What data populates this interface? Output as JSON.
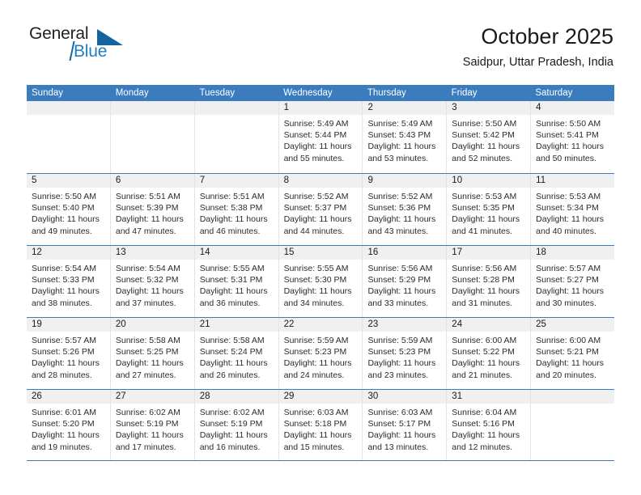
{
  "brand": {
    "name_part1": "General",
    "name_part2": "Blue",
    "accent_color": "#1f7ec4",
    "logo_icon": "triangle-flag-icon"
  },
  "header": {
    "month_title": "October 2025",
    "location": "Saidpur, Uttar Pradesh, India"
  },
  "calendar": {
    "header_color": "#3a7cbe",
    "day_band_color": "#f0f0f0",
    "weekdays": [
      "Sunday",
      "Monday",
      "Tuesday",
      "Wednesday",
      "Thursday",
      "Friday",
      "Saturday"
    ],
    "weeks": [
      [
        {
          "empty": true
        },
        {
          "empty": true
        },
        {
          "empty": true
        },
        {
          "day": "1",
          "sunrise": "Sunrise: 5:49 AM",
          "sunset": "Sunset: 5:44 PM",
          "daylight1": "Daylight: 11 hours",
          "daylight2": "and 55 minutes."
        },
        {
          "day": "2",
          "sunrise": "Sunrise: 5:49 AM",
          "sunset": "Sunset: 5:43 PM",
          "daylight1": "Daylight: 11 hours",
          "daylight2": "and 53 minutes."
        },
        {
          "day": "3",
          "sunrise": "Sunrise: 5:50 AM",
          "sunset": "Sunset: 5:42 PM",
          "daylight1": "Daylight: 11 hours",
          "daylight2": "and 52 minutes."
        },
        {
          "day": "4",
          "sunrise": "Sunrise: 5:50 AM",
          "sunset": "Sunset: 5:41 PM",
          "daylight1": "Daylight: 11 hours",
          "daylight2": "and 50 minutes."
        }
      ],
      [
        {
          "day": "5",
          "sunrise": "Sunrise: 5:50 AM",
          "sunset": "Sunset: 5:40 PM",
          "daylight1": "Daylight: 11 hours",
          "daylight2": "and 49 minutes."
        },
        {
          "day": "6",
          "sunrise": "Sunrise: 5:51 AM",
          "sunset": "Sunset: 5:39 PM",
          "daylight1": "Daylight: 11 hours",
          "daylight2": "and 47 minutes."
        },
        {
          "day": "7",
          "sunrise": "Sunrise: 5:51 AM",
          "sunset": "Sunset: 5:38 PM",
          "daylight1": "Daylight: 11 hours",
          "daylight2": "and 46 minutes."
        },
        {
          "day": "8",
          "sunrise": "Sunrise: 5:52 AM",
          "sunset": "Sunset: 5:37 PM",
          "daylight1": "Daylight: 11 hours",
          "daylight2": "and 44 minutes."
        },
        {
          "day": "9",
          "sunrise": "Sunrise: 5:52 AM",
          "sunset": "Sunset: 5:36 PM",
          "daylight1": "Daylight: 11 hours",
          "daylight2": "and 43 minutes."
        },
        {
          "day": "10",
          "sunrise": "Sunrise: 5:53 AM",
          "sunset": "Sunset: 5:35 PM",
          "daylight1": "Daylight: 11 hours",
          "daylight2": "and 41 minutes."
        },
        {
          "day": "11",
          "sunrise": "Sunrise: 5:53 AM",
          "sunset": "Sunset: 5:34 PM",
          "daylight1": "Daylight: 11 hours",
          "daylight2": "and 40 minutes."
        }
      ],
      [
        {
          "day": "12",
          "sunrise": "Sunrise: 5:54 AM",
          "sunset": "Sunset: 5:33 PM",
          "daylight1": "Daylight: 11 hours",
          "daylight2": "and 38 minutes."
        },
        {
          "day": "13",
          "sunrise": "Sunrise: 5:54 AM",
          "sunset": "Sunset: 5:32 PM",
          "daylight1": "Daylight: 11 hours",
          "daylight2": "and 37 minutes."
        },
        {
          "day": "14",
          "sunrise": "Sunrise: 5:55 AM",
          "sunset": "Sunset: 5:31 PM",
          "daylight1": "Daylight: 11 hours",
          "daylight2": "and 36 minutes."
        },
        {
          "day": "15",
          "sunrise": "Sunrise: 5:55 AM",
          "sunset": "Sunset: 5:30 PM",
          "daylight1": "Daylight: 11 hours",
          "daylight2": "and 34 minutes."
        },
        {
          "day": "16",
          "sunrise": "Sunrise: 5:56 AM",
          "sunset": "Sunset: 5:29 PM",
          "daylight1": "Daylight: 11 hours",
          "daylight2": "and 33 minutes."
        },
        {
          "day": "17",
          "sunrise": "Sunrise: 5:56 AM",
          "sunset": "Sunset: 5:28 PM",
          "daylight1": "Daylight: 11 hours",
          "daylight2": "and 31 minutes."
        },
        {
          "day": "18",
          "sunrise": "Sunrise: 5:57 AM",
          "sunset": "Sunset: 5:27 PM",
          "daylight1": "Daylight: 11 hours",
          "daylight2": "and 30 minutes."
        }
      ],
      [
        {
          "day": "19",
          "sunrise": "Sunrise: 5:57 AM",
          "sunset": "Sunset: 5:26 PM",
          "daylight1": "Daylight: 11 hours",
          "daylight2": "and 28 minutes."
        },
        {
          "day": "20",
          "sunrise": "Sunrise: 5:58 AM",
          "sunset": "Sunset: 5:25 PM",
          "daylight1": "Daylight: 11 hours",
          "daylight2": "and 27 minutes."
        },
        {
          "day": "21",
          "sunrise": "Sunrise: 5:58 AM",
          "sunset": "Sunset: 5:24 PM",
          "daylight1": "Daylight: 11 hours",
          "daylight2": "and 26 minutes."
        },
        {
          "day": "22",
          "sunrise": "Sunrise: 5:59 AM",
          "sunset": "Sunset: 5:23 PM",
          "daylight1": "Daylight: 11 hours",
          "daylight2": "and 24 minutes."
        },
        {
          "day": "23",
          "sunrise": "Sunrise: 5:59 AM",
          "sunset": "Sunset: 5:23 PM",
          "daylight1": "Daylight: 11 hours",
          "daylight2": "and 23 minutes."
        },
        {
          "day": "24",
          "sunrise": "Sunrise: 6:00 AM",
          "sunset": "Sunset: 5:22 PM",
          "daylight1": "Daylight: 11 hours",
          "daylight2": "and 21 minutes."
        },
        {
          "day": "25",
          "sunrise": "Sunrise: 6:00 AM",
          "sunset": "Sunset: 5:21 PM",
          "daylight1": "Daylight: 11 hours",
          "daylight2": "and 20 minutes."
        }
      ],
      [
        {
          "day": "26",
          "sunrise": "Sunrise: 6:01 AM",
          "sunset": "Sunset: 5:20 PM",
          "daylight1": "Daylight: 11 hours",
          "daylight2": "and 19 minutes."
        },
        {
          "day": "27",
          "sunrise": "Sunrise: 6:02 AM",
          "sunset": "Sunset: 5:19 PM",
          "daylight1": "Daylight: 11 hours",
          "daylight2": "and 17 minutes."
        },
        {
          "day": "28",
          "sunrise": "Sunrise: 6:02 AM",
          "sunset": "Sunset: 5:19 PM",
          "daylight1": "Daylight: 11 hours",
          "daylight2": "and 16 minutes."
        },
        {
          "day": "29",
          "sunrise": "Sunrise: 6:03 AM",
          "sunset": "Sunset: 5:18 PM",
          "daylight1": "Daylight: 11 hours",
          "daylight2": "and 15 minutes."
        },
        {
          "day": "30",
          "sunrise": "Sunrise: 6:03 AM",
          "sunset": "Sunset: 5:17 PM",
          "daylight1": "Daylight: 11 hours",
          "daylight2": "and 13 minutes."
        },
        {
          "day": "31",
          "sunrise": "Sunrise: 6:04 AM",
          "sunset": "Sunset: 5:16 PM",
          "daylight1": "Daylight: 11 hours",
          "daylight2": "and 12 minutes."
        },
        {
          "empty": true
        }
      ]
    ]
  }
}
